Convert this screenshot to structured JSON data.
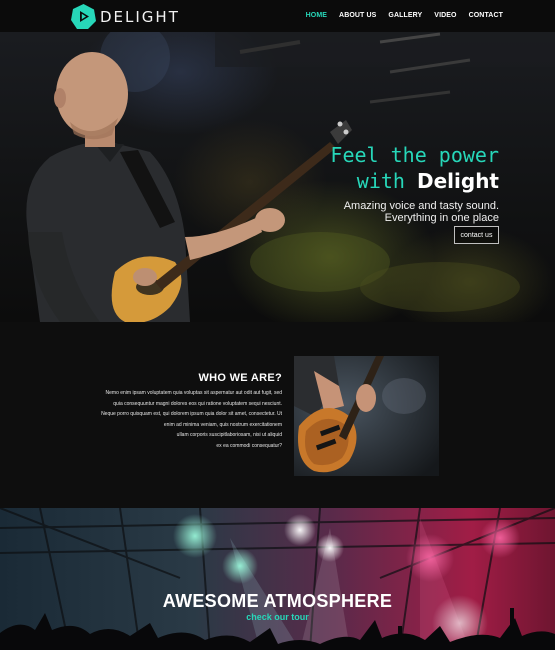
{
  "brand": {
    "name": "DELIGHT",
    "accent": "#27d7b9"
  },
  "nav": {
    "items": [
      {
        "label": "HOME",
        "active": true
      },
      {
        "label": "ABOUT US",
        "active": false
      },
      {
        "label": "GALLERY",
        "active": false
      },
      {
        "label": "VIDEO",
        "active": false
      },
      {
        "label": "CONTACT",
        "active": false
      }
    ]
  },
  "hero": {
    "line1": "Feel the power",
    "line2_prefix": "with ",
    "line2_brand": "Delight",
    "subtitle1": "Amazing voice and tasty sound.",
    "subtitle2": "Everything in one place",
    "button_label": "contact us",
    "image": "bass-guitarist-photo"
  },
  "about": {
    "title": "WHO WE ARE?",
    "body_lines": [
      "Nemo enim ipsam voluptatem quia voluptas sit aspernatur aut odit aut fugit, sed",
      "quia consequuntur magni dolores eos qui ratione voluptatem sequi nesciunt.",
      "Neque porro quisquam est, qui dolorem ipsum quia dolor sit amet, consectetur. Ut",
      "enim ad minima veniam, quis nostrum exercitationem",
      "ullam corporis suscipitlaboriosam, nisi ut aliquid",
      "ex ea commodi consequatur?"
    ],
    "image": "guitar-closeup-photo"
  },
  "atmosphere": {
    "title": "AWESOME ATMOSPHERE",
    "link_label": "check our tour",
    "image": "concert-crowd-photo"
  }
}
